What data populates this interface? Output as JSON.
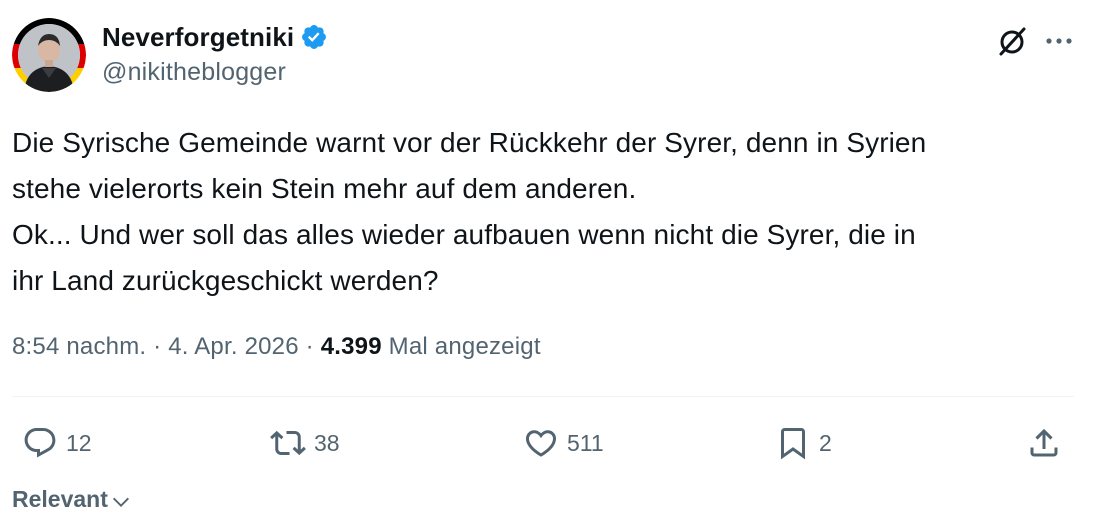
{
  "author": {
    "display_name": "Neverforgetniki",
    "handle": "@nikitheblogger",
    "verified": true,
    "avatar_icon": "avatar-photo"
  },
  "header_icons": {
    "grok": "grok-icon",
    "more": "more-icon"
  },
  "tweet": {
    "lines": [
      "Die Syrische Gemeinde warnt vor der Rückkehr der Syrer, denn in Syrien",
      "stehe vielerorts kein Stein mehr auf dem anderen.",
      "Ok... Und wer soll das alles wieder aufbauen wenn nicht die Syrer, die in",
      "ihr Land zurückgeschickt werden?"
    ]
  },
  "meta": {
    "time": "8:54 nachm.",
    "separator": "·",
    "date": "4. Apr. 2026",
    "views_count": "4.399",
    "views_label": "Mal angezeigt"
  },
  "actions": {
    "reply_count": "12",
    "repost_count": "38",
    "like_count": "511",
    "bookmark_count": "2"
  },
  "sort": {
    "label": "Relevant"
  },
  "colors": {
    "text": "#0f1419",
    "secondary": "#536471",
    "verified_blue": "#1d9bf0",
    "divider": "#eff3f4",
    "flag_black": "#000000",
    "flag_red": "#dd0000",
    "flag_gold": "#ffce00"
  }
}
